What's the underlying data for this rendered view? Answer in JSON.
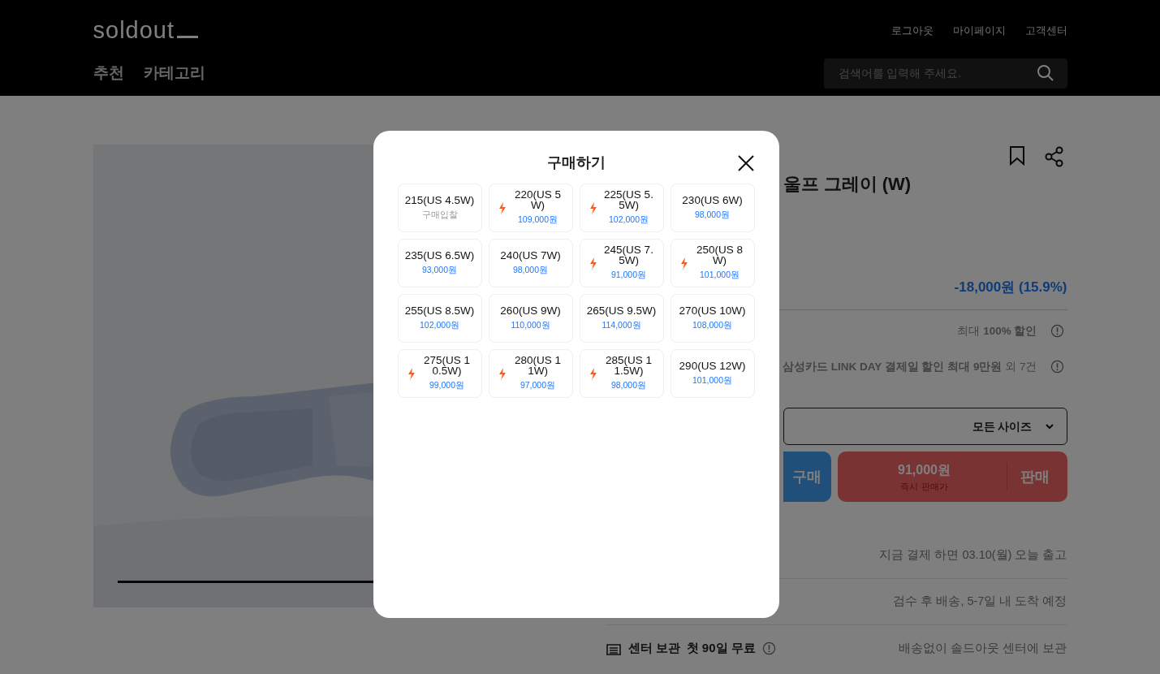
{
  "header": {
    "logo": "soldout",
    "top_links": [
      "로그아웃",
      "마이페이지",
      "고객센터"
    ],
    "nav": [
      "추천",
      "카테고리"
    ],
    "search": {
      "placeholder": "검색어를 입력해 주세요."
    }
  },
  "product": {
    "title": "울프 그레이 (W)",
    "discount": "-18,000원 (15.9%)",
    "benefits": [
      "최대 **100% 할인**",
      "**삼성카드 LINK DAY 결제일 할인 최대 9만원** 외 7건"
    ],
    "size_select": "모든 사이즈",
    "buy_button": {
      "label": "구매"
    },
    "sell_button": {
      "price": "91,000원",
      "caption": "즉시 판매가",
      "label": "판매"
    },
    "delivery": [
      {
        "kind": "plain",
        "value": "지금 결제 하면 03.10(월) 오늘 출고"
      },
      {
        "kind": "plain",
        "value": "검수 후 배송, 5-7일 내 도착 예정"
      },
      {
        "kind": "storage",
        "label": "센터 보관",
        "highlight": "첫 90일 무료",
        "value": "배송없이 솔드아웃 센터에 보관"
      }
    ]
  },
  "modal": {
    "title": "구매하기",
    "sizes": [
      {
        "size": "215(US 4.5W)",
        "fast": false,
        "kind": "bid",
        "sub": "구매입찰"
      },
      {
        "size": "220(US 5W)",
        "fast": true,
        "kind": "price",
        "sub": "109,000원"
      },
      {
        "size": "225(US 5.5W)",
        "fast": true,
        "kind": "price",
        "sub": "102,000원"
      },
      {
        "size": "230(US 6W)",
        "fast": false,
        "kind": "price",
        "sub": "98,000원"
      },
      {
        "size": "235(US 6.5W)",
        "fast": false,
        "kind": "price",
        "sub": "93,000원"
      },
      {
        "size": "240(US 7W)",
        "fast": false,
        "kind": "price",
        "sub": "98,000원"
      },
      {
        "size": "245(US 7.5W)",
        "fast": true,
        "kind": "price",
        "sub": "91,000원"
      },
      {
        "size": "250(US 8W)",
        "fast": true,
        "kind": "price",
        "sub": "101,000원"
      },
      {
        "size": "255(US 8.5W)",
        "fast": false,
        "kind": "price",
        "sub": "102,000원"
      },
      {
        "size": "260(US 9W)",
        "fast": false,
        "kind": "price",
        "sub": "110,000원"
      },
      {
        "size": "265(US 9.5W)",
        "fast": false,
        "kind": "price",
        "sub": "114,000원"
      },
      {
        "size": "270(US 10W)",
        "fast": false,
        "kind": "price",
        "sub": "108,000원"
      },
      {
        "size": "275(US 10.5W)",
        "fast": true,
        "kind": "price",
        "sub": "99,000원"
      },
      {
        "size": "280(US 11W)",
        "fast": true,
        "kind": "price",
        "sub": "97,000원"
      },
      {
        "size": "285(US 11.5W)",
        "fast": true,
        "kind": "price",
        "sub": "98,000원"
      },
      {
        "size": "290(US 12W)",
        "fast": false,
        "kind": "price",
        "sub": "101,000원"
      }
    ]
  }
}
